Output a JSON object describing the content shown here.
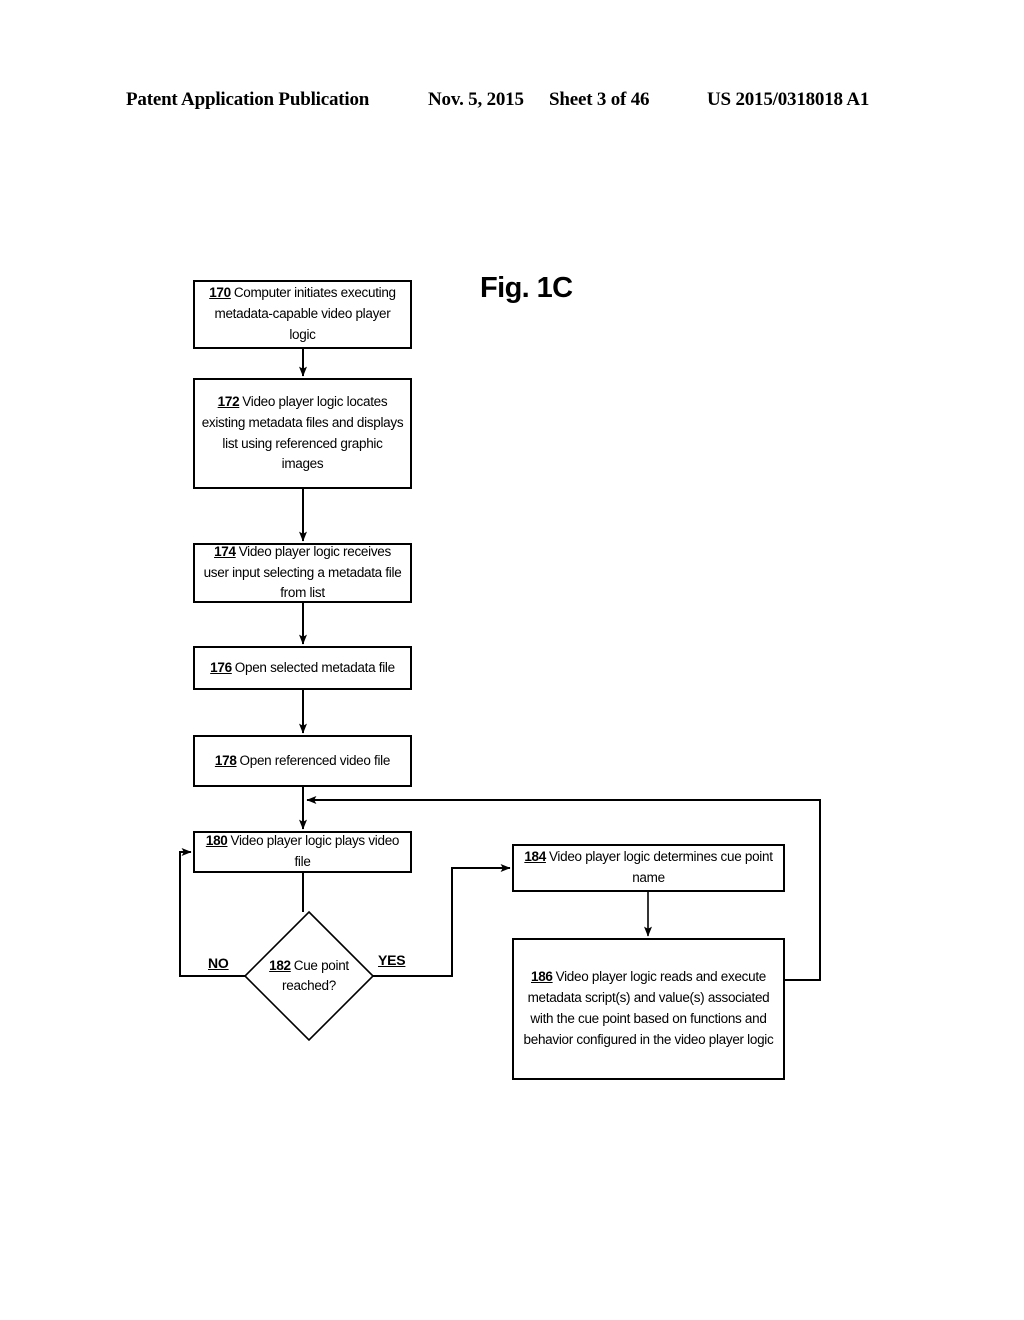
{
  "header": {
    "publication": "Patent Application Publication",
    "date": "Nov. 5, 2015",
    "sheet": "Sheet 3 of 46",
    "patent_number": "US 2015/0318018 A1"
  },
  "figure": {
    "title": "Fig. 1C",
    "type": "flowchart"
  },
  "nodes": {
    "n170": {
      "ref": "170",
      "text": "Computer initiates executing metadata-capable video player logic",
      "shape": "process"
    },
    "n172": {
      "ref": "172",
      "text": "Video player logic locates existing metadata files and displays list using referenced graphic images",
      "shape": "process"
    },
    "n174": {
      "ref": "174",
      "text": "Video player logic receives user input selecting a metadata file from list",
      "shape": "process"
    },
    "n176": {
      "ref": "176",
      "text": "Open selected metadata file",
      "shape": "process"
    },
    "n178": {
      "ref": "178",
      "text": "Open referenced video file",
      "shape": "process"
    },
    "n180": {
      "ref": "180",
      "text": "Video player logic plays video file",
      "shape": "process"
    },
    "n182": {
      "ref": "182",
      "text": "Cue point reached?",
      "shape": "decision"
    },
    "n184": {
      "ref": "184",
      "text": "Video player logic determines cue point name",
      "shape": "process"
    },
    "n186": {
      "ref": "186",
      "text": "Video player logic reads and execute metadata script(s) and value(s) associated with the cue point based on functions and behavior configured in the video player logic",
      "shape": "process"
    }
  },
  "edges": {
    "no_label": "NO",
    "yes_label": "YES"
  },
  "colors": {
    "stroke": "#000000",
    "background": "#ffffff"
  }
}
